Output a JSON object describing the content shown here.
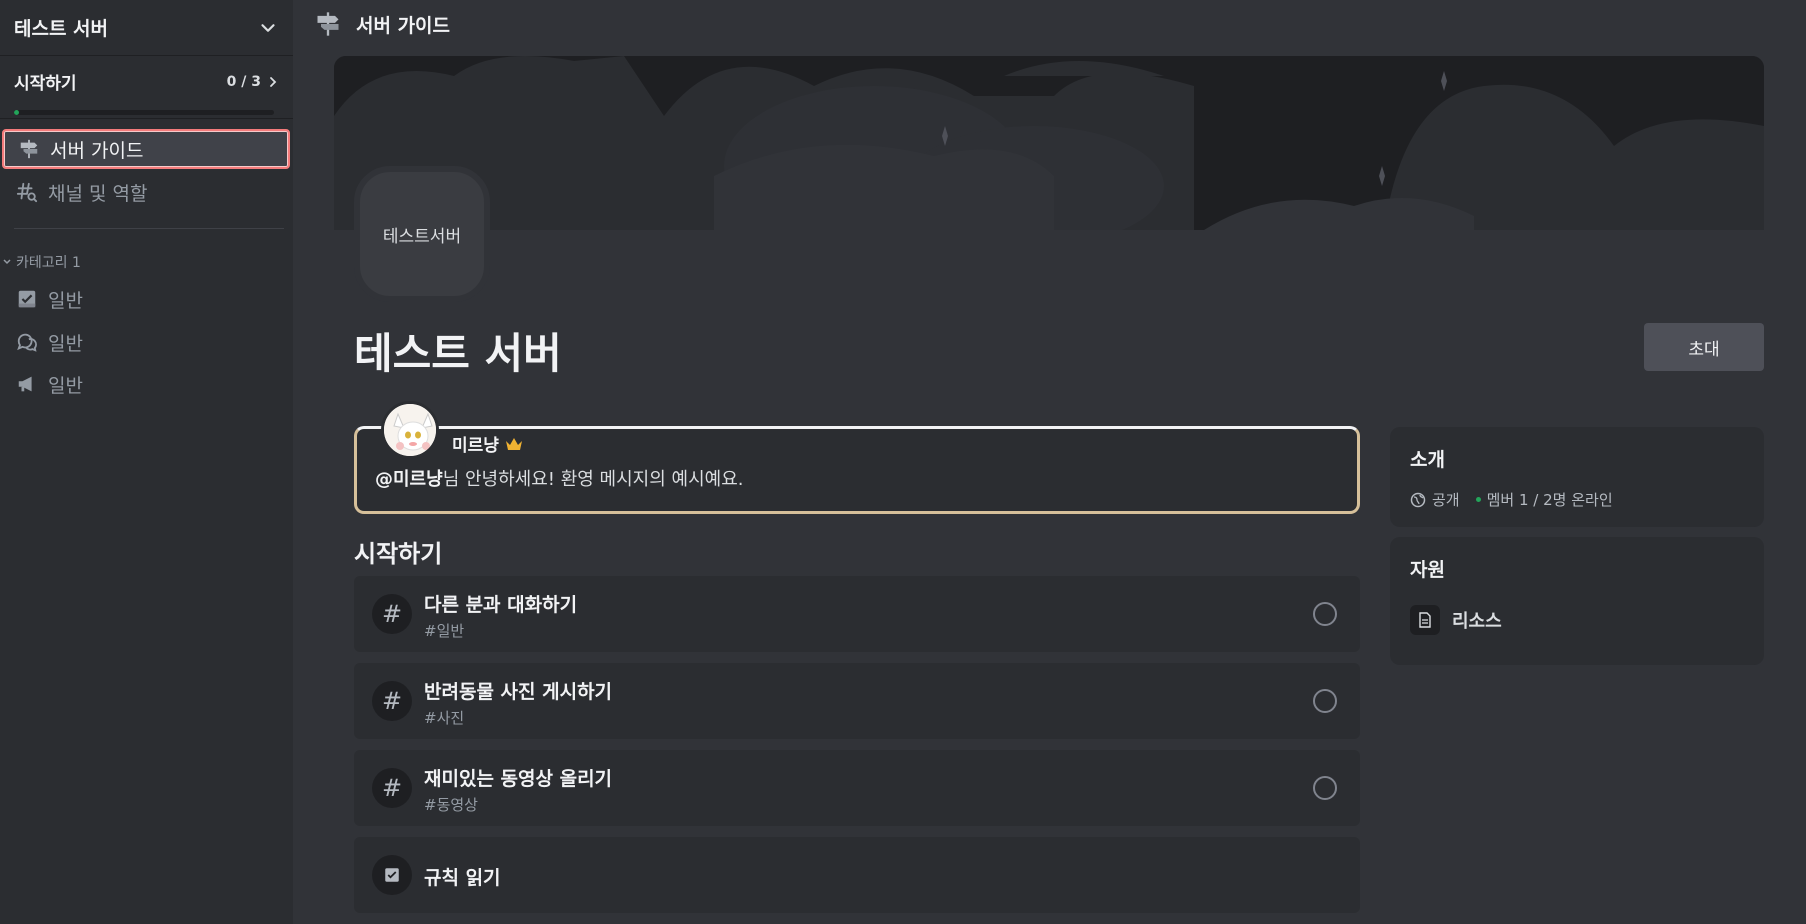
{
  "sidebar": {
    "server_name": "테스트 서버",
    "onboarding": {
      "title": "시작하기",
      "count": "0 / 3",
      "progress_fraction": 0.02
    },
    "nav": [
      {
        "label": "서버 가이드",
        "icon": "signpost-icon",
        "active": true
      },
      {
        "label": "채널 및 역할",
        "icon": "channel-browse-icon",
        "active": false
      }
    ],
    "category": {
      "label": "카테고리 1"
    },
    "channels": [
      {
        "label": "일반",
        "icon": "rules-channel-icon"
      },
      {
        "label": "일반",
        "icon": "forum-channel-icon"
      },
      {
        "label": "일반",
        "icon": "announcement-channel-icon"
      }
    ]
  },
  "topbar": {
    "title": "서버 가이드",
    "icon": "signpost-icon"
  },
  "main": {
    "server_icon_text": "테스트서버",
    "title": "테스트 서버",
    "invite_label": "초대",
    "welcome": {
      "author": "미르냥",
      "mention": "@미르냥",
      "message": "님 안녕하세요! 환영 메시지의 예시예요."
    },
    "tasks_title": "시작하기",
    "tasks": [
      {
        "name": "다른 분과 대화하기",
        "channel": "#일반",
        "icon": "#"
      },
      {
        "name": "반려동물 사진 게시하기",
        "channel": "#사진",
        "icon": "#"
      },
      {
        "name": "재미있는 동영상 올리기",
        "channel": "#동영상",
        "icon": "#"
      }
    ],
    "rules_task": {
      "name": "규칙 읽기"
    },
    "about": {
      "title": "소개",
      "visibility": "공개",
      "members": "멤버 1 / 2명 온라인"
    },
    "resources": {
      "title": "자원",
      "item": "리소스"
    }
  },
  "colors": {
    "accent_green": "#23a55a",
    "highlight_border": "#f47b7b",
    "welcome_border": "#d6c09a"
  }
}
